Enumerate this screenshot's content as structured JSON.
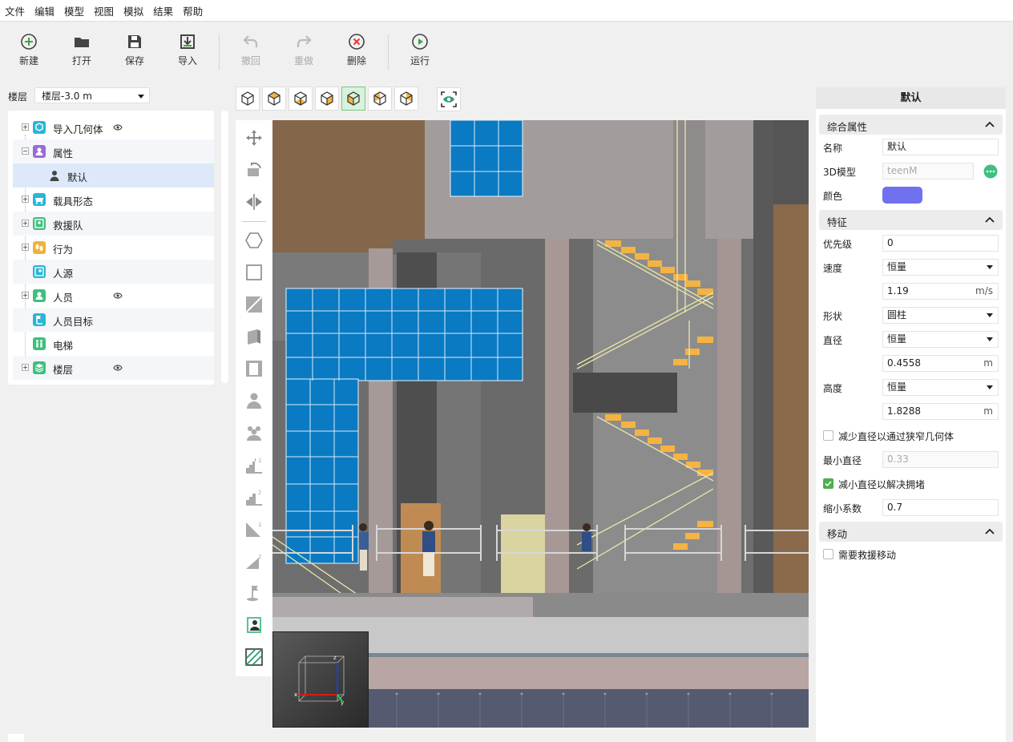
{
  "menu": [
    "文件",
    "编辑",
    "模型",
    "视图",
    "模拟",
    "结果",
    "帮助"
  ],
  "toolbar": {
    "new": "新建",
    "open": "打开",
    "save": "保存",
    "import": "导入",
    "undo": "撤回",
    "redo": "重做",
    "delete": "删除",
    "run": "运行"
  },
  "floor": {
    "label": "楼层",
    "selected": "楼层-3.0 m"
  },
  "tree": {
    "items": [
      {
        "label": "导入几何体",
        "icon": "geometry-icon",
        "color": "#29b6d6"
      },
      {
        "label": "属性",
        "icon": "profile-icon",
        "color": "#9b6bd6"
      },
      {
        "label": "默认",
        "icon": "person-icon",
        "color": "#444444"
      },
      {
        "label": "载具形态",
        "icon": "vehicle-icon",
        "color": "#29b6d6"
      },
      {
        "label": "救援队",
        "icon": "rescue-team-icon",
        "color": "#3fbf7f"
      },
      {
        "label": "行为",
        "icon": "behavior-icon",
        "color": "#f2b233"
      },
      {
        "label": "人源",
        "icon": "occupant-source-icon",
        "color": "#29b6d6"
      },
      {
        "label": "人员",
        "icon": "occupants-icon",
        "color": "#3fbf7f"
      },
      {
        "label": "人员目标",
        "icon": "occupant-target-icon",
        "color": "#29b6d6"
      },
      {
        "label": "电梯",
        "icon": "elevator-icon",
        "color": "#3fbf7f"
      },
      {
        "label": "楼层",
        "icon": "floors-icon",
        "color": "#3fbf7f"
      }
    ]
  },
  "panel": {
    "title": "默认",
    "sections": {
      "general": "综合属性",
      "features": "特征",
      "movement": "移动"
    },
    "name_label": "名称",
    "name_value": "默认",
    "model_label": "3D模型",
    "model_value": "teenM",
    "color_label": "颜色",
    "color_value": "#7070f0",
    "priority_label": "优先级",
    "priority_value": "0",
    "speed_label": "速度",
    "speed_mode": "恒量",
    "speed_value": "1.19",
    "speed_unit": "m/s",
    "shape_label": "形状",
    "shape_value": "圆柱",
    "diameter_label": "直径",
    "diameter_mode": "恒量",
    "diameter_value": "0.4558",
    "diameter_unit": "m",
    "height_label": "高度",
    "height_mode": "恒量",
    "height_value": "1.8288",
    "height_unit": "m",
    "reduce_narrow_label": "减少直径以通过狭窄几何体",
    "min_diameter_label": "最小直径",
    "min_diameter_value": "0.33",
    "reduce_congestion_label": "减小直径以解决拥堵",
    "shrink_label": "缩小系数",
    "shrink_value": "0.7",
    "need_rescue_label": "需要救援移动"
  },
  "minimap": {
    "x": "x",
    "y": "y",
    "z": "z"
  }
}
